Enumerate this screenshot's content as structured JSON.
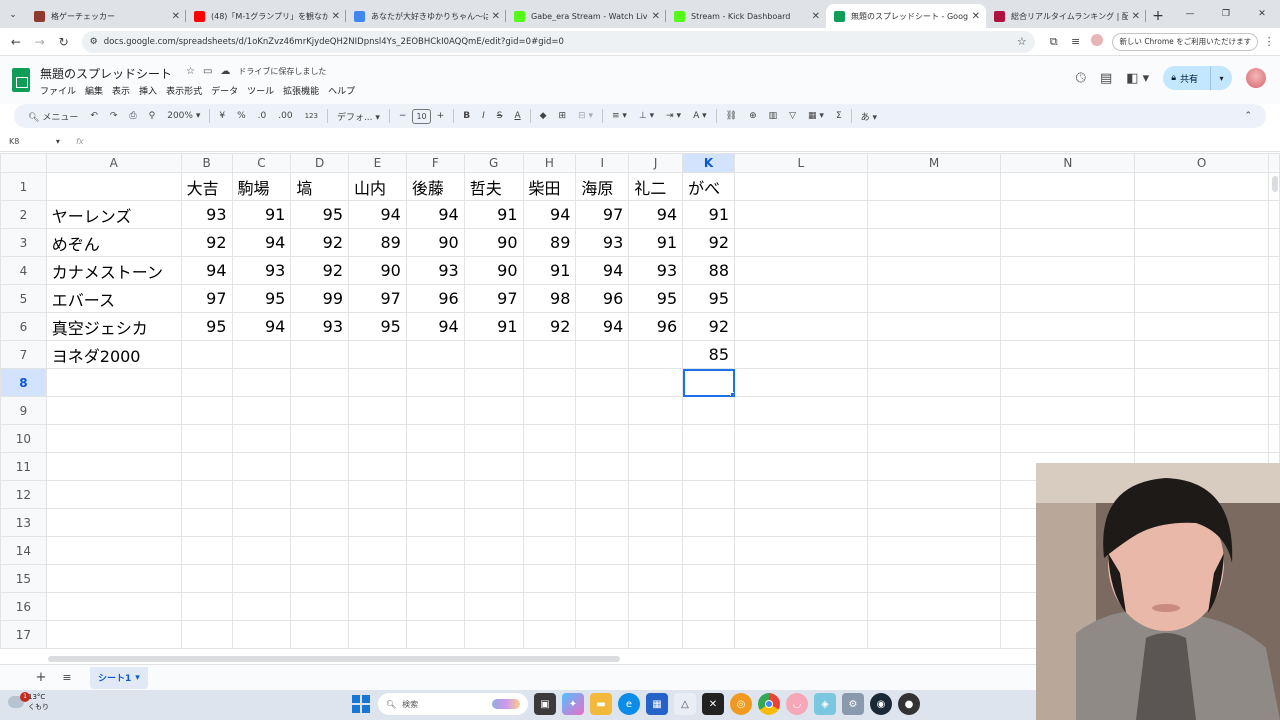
{
  "browser": {
    "tabs": [
      {
        "title": "格ゲーチェッカー",
        "color": "#8e3b2e"
      },
      {
        "title": "(48)「M-1グランプリ」を観ながら雑談",
        "color": "#ff0000"
      },
      {
        "title": "あなたが大好きゆかりちゃん～ばんて",
        "color": "#4285f4"
      },
      {
        "title": "Gabe_era Stream - Watch Live",
        "color": "#53fc18"
      },
      {
        "title": "Stream - Kick Dashboard",
        "color": "#53fc18"
      },
      {
        "title": "無題のスプレッドシート - Google ス",
        "color": "#0f9d58",
        "active": true
      },
      {
        "title": "総合リアルタイムランキング | 配信者",
        "color": "#b0123f"
      }
    ],
    "url": "docs.google.com/spreadsheets/d/1oKnZvz46mrKjydeQH2NIDpnsl4Ys_2EOBHCkI0AQQmE/edit?gid=0#gid=0",
    "chrome_badge": "新しい Chrome をご利用いただけます"
  },
  "doc": {
    "title": "無題のスプレッドシート",
    "save_status": "ドライブに保存しました",
    "menus": [
      "ファイル",
      "編集",
      "表示",
      "挿入",
      "表示形式",
      "データ",
      "ツール",
      "拡張機能",
      "ヘルプ"
    ],
    "share_label": "共有"
  },
  "toolbar": {
    "search_label": "メニュー",
    "zoom": "200%",
    "currency": "¥",
    "percent": "%",
    "dec_less": ".0",
    "dec_more": ".00",
    "number_format": "123",
    "font": "デフォ...",
    "font_size": "10"
  },
  "formula_bar": {
    "cell_ref": "K8",
    "fx": "fx"
  },
  "grid": {
    "columns": [
      "A",
      "B",
      "C",
      "D",
      "E",
      "F",
      "G",
      "H",
      "I",
      "J",
      "K",
      "L",
      "M",
      "N",
      "O"
    ],
    "row_numbers": [
      "1",
      "2",
      "3",
      "4",
      "5",
      "6",
      "7",
      "8",
      "9",
      "10",
      "11",
      "12",
      "13",
      "14",
      "15",
      "16",
      "17"
    ],
    "selected_column": "K",
    "selected_row": "8",
    "header_row": [
      "",
      "大吉",
      "駒場",
      "塙",
      "山内",
      "後藤",
      "哲夫",
      "柴田",
      "海原",
      "礼二",
      "がべ"
    ],
    "rows": [
      {
        "name": "ヤーレンズ",
        "scores": [
          "93",
          "91",
          "95",
          "94",
          "94",
          "91",
          "94",
          "97",
          "94",
          "91"
        ]
      },
      {
        "name": "めぞん",
        "scores": [
          "92",
          "94",
          "92",
          "89",
          "90",
          "90",
          "89",
          "93",
          "91",
          "92"
        ]
      },
      {
        "name": "カナメストーン",
        "scores": [
          "94",
          "93",
          "92",
          "90",
          "93",
          "90",
          "91",
          "94",
          "93",
          "88"
        ]
      },
      {
        "name": "エバース",
        "scores": [
          "97",
          "95",
          "99",
          "97",
          "96",
          "97",
          "98",
          "96",
          "95",
          "95"
        ]
      },
      {
        "name": "真空ジェシカ",
        "scores": [
          "95",
          "94",
          "93",
          "95",
          "94",
          "91",
          "92",
          "94",
          "96",
          "92"
        ]
      },
      {
        "name": "ヨネダ2000",
        "scores": [
          "",
          "",
          "",
          "",
          "",
          "",
          "",
          "",
          "",
          "85"
        ]
      }
    ]
  },
  "sheets": {
    "tabs": [
      "シート1"
    ]
  },
  "taskbar": {
    "alert_count": "1",
    "temperature": "13°C",
    "weather": "くもり",
    "search_placeholder": "検索"
  }
}
